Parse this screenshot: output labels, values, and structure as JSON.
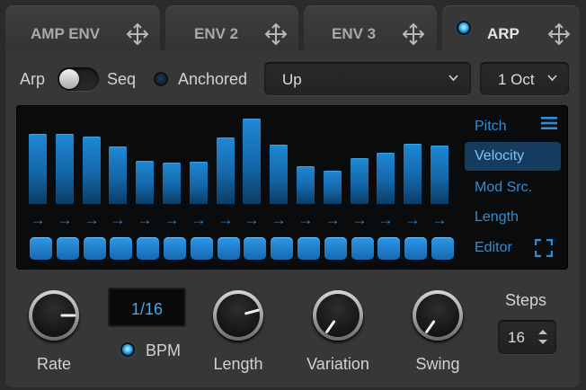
{
  "tabs": [
    {
      "label": "AMP ENV",
      "active": false,
      "icon": "move-icon"
    },
    {
      "label": "ENV 2",
      "active": false,
      "icon": "move-icon"
    },
    {
      "label": "ENV 3",
      "active": false,
      "icon": "move-icon"
    },
    {
      "label": "ARP",
      "active": true,
      "icon": "move-icon"
    }
  ],
  "mode": {
    "left_label": "Arp",
    "right_label": "Seq",
    "value": "Arp"
  },
  "anchored": {
    "label": "Anchored",
    "on": false
  },
  "direction": {
    "value": "Up"
  },
  "octave": {
    "value": "1 Oct"
  },
  "editor": {
    "velocities": [
      0.82,
      0.82,
      0.79,
      0.67,
      0.5,
      0.48,
      0.49,
      0.78,
      1.0,
      0.69,
      0.44,
      0.39,
      0.54,
      0.6,
      0.7,
      0.68
    ],
    "step_count": 16,
    "menu": [
      {
        "label": "Pitch",
        "selected": false
      },
      {
        "label": "Velocity",
        "selected": true
      },
      {
        "label": "Mod Src.",
        "selected": false
      },
      {
        "label": "Length",
        "selected": false
      },
      {
        "label": "Editor",
        "selected": false
      }
    ],
    "arrow_glyph": "→"
  },
  "knobs": {
    "rate": {
      "label": "Rate",
      "angle_deg": 90
    },
    "length": {
      "label": "Length",
      "angle_deg": 75
    },
    "variation": {
      "label": "Variation",
      "angle_deg": -145
    },
    "swing": {
      "label": "Swing",
      "angle_deg": -145
    }
  },
  "rate_display": {
    "value": "1/16"
  },
  "bpm": {
    "label": "BPM",
    "on": true
  },
  "steps": {
    "label": "Steps",
    "value": "16"
  },
  "colors": {
    "accent": "#2e8fd6",
    "bar_top": "#1f88d6",
    "panel": "#373738",
    "editor_bg": "#0a0b0d"
  }
}
